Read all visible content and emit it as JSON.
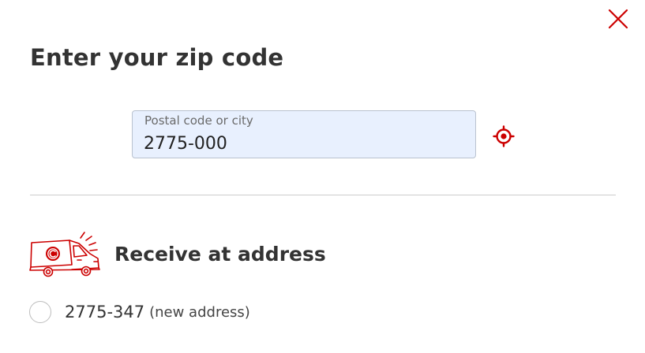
{
  "dialog": {
    "title": "Enter your zip code",
    "close_icon": "close-icon"
  },
  "zip_field": {
    "label": "Postal code or city",
    "value": "2775-000",
    "locate_icon": "target-location-icon"
  },
  "delivery_section": {
    "icon": "delivery-van-icon",
    "title": "Receive at address",
    "options": [
      {
        "zip": "2775-347",
        "note": "(new address)",
        "selected": false
      }
    ]
  },
  "colors": {
    "accent": "#cc0000",
    "field_background": "#e8f0fe",
    "text": "#333333"
  }
}
